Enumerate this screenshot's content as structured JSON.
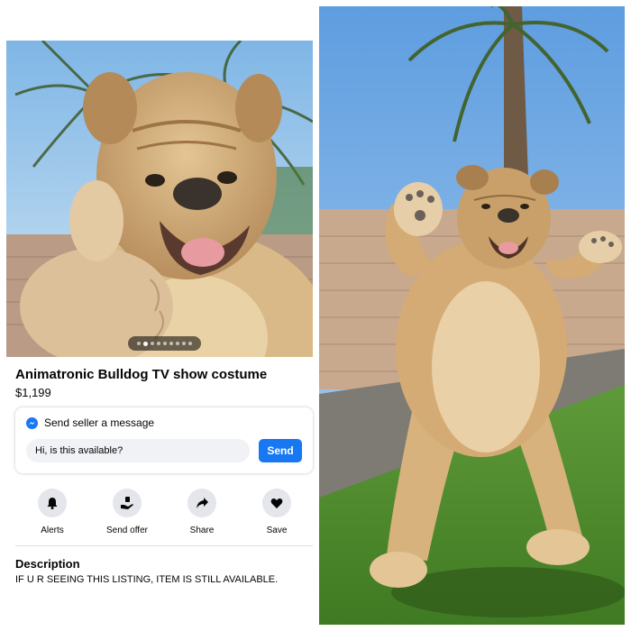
{
  "listing": {
    "title": "Animatronic Bulldog TV show costume",
    "price": "$1,199"
  },
  "carousel": {
    "photo_count": 9,
    "active_index": 1
  },
  "message": {
    "heading": "Send seller a message",
    "input_value": "Hi, is this available?",
    "send_label": "Send",
    "icon": "messenger-icon"
  },
  "actions": [
    {
      "label": "Alerts",
      "icon": "bell-icon"
    },
    {
      "label": "Send offer",
      "icon": "offer-icon"
    },
    {
      "label": "Share",
      "icon": "share-icon"
    },
    {
      "label": "Save",
      "icon": "heart-icon"
    }
  ],
  "description": {
    "heading": "Description",
    "text": "IF U R SEEING THIS LISTING, ITEM IS STILL AVAILABLE."
  },
  "colors": {
    "accent": "#1877f2",
    "button_bg": "#e4e6eb",
    "input_bg": "#f0f2f5"
  }
}
